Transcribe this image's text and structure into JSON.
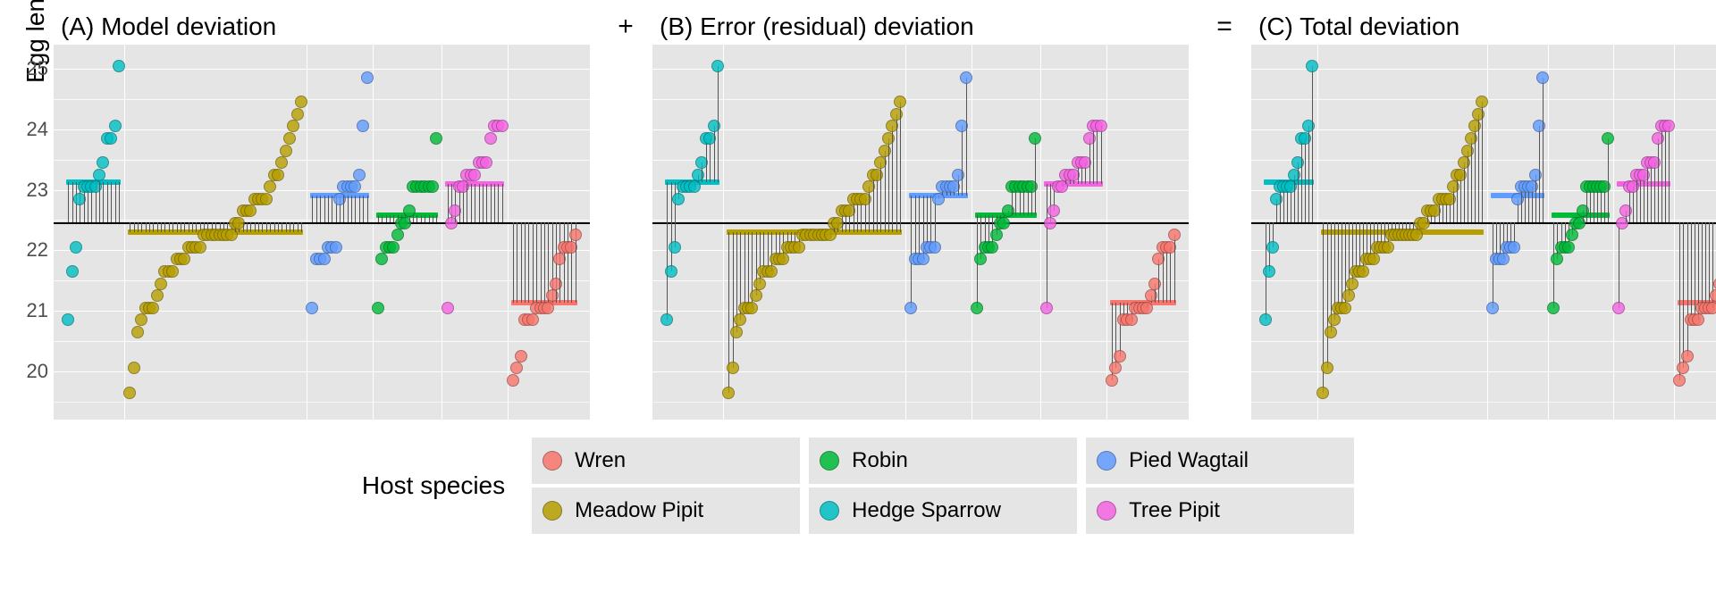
{
  "chart_data": {
    "type": "scatter",
    "ylabel": "Egg length",
    "xlabel_title": "Host species",
    "ylim": [
      19.2,
      25.4
    ],
    "yticks_major": [
      20,
      21,
      22,
      23,
      24,
      25
    ],
    "grand_mean": 22.46,
    "panels": [
      {
        "key": "A",
        "title": "(A) Model deviation",
        "after": "+",
        "stems_from": "baseline_to_mean"
      },
      {
        "key": "B",
        "title": "(B) Error (residual) deviation",
        "after": "=",
        "stems_from": "mean_to_point"
      },
      {
        "key": "C",
        "title": "(C) Total deviation",
        "after": "",
        "stems_from": "baseline_to_point"
      }
    ],
    "species_order": [
      "Hedge Sparrow",
      "Meadow Pipit",
      "Pied Wagtail",
      "Robin",
      "Tree Pipit",
      "Wren"
    ],
    "colors": {
      "Wren": "#f8766d",
      "Meadow Pipit": "#b79f00",
      "Robin": "#00ba38",
      "Hedge Sparrow": "#00bfc4",
      "Pied Wagtail": "#619cff",
      "Tree Pipit": "#f564e3"
    },
    "group_means": {
      "Hedge Sparrow": 23.12,
      "Meadow Pipit": 22.3,
      "Pied Wagtail": 22.9,
      "Robin": 22.58,
      "Tree Pipit": 23.09,
      "Wren": 21.13
    },
    "series": {
      "Hedge Sparrow": [
        20.85,
        21.65,
        22.05,
        22.85,
        23.05,
        23.05,
        23.05,
        23.05,
        23.25,
        23.45,
        23.85,
        23.85,
        24.05,
        25.05
      ],
      "Meadow Pipit": [
        19.65,
        20.05,
        20.65,
        20.85,
        21.05,
        21.05,
        21.05,
        21.25,
        21.45,
        21.65,
        21.65,
        21.65,
        21.85,
        21.85,
        21.85,
        22.05,
        22.05,
        22.05,
        22.05,
        22.25,
        22.25,
        22.25,
        22.25,
        22.25,
        22.25,
        22.25,
        22.25,
        22.45,
        22.45,
        22.65,
        22.65,
        22.65,
        22.85,
        22.85,
        22.85,
        22.85,
        23.05,
        23.25,
        23.25,
        23.45,
        23.65,
        23.85,
        24.05,
        24.25,
        24.45
      ],
      "Pied Wagtail": [
        21.05,
        21.85,
        21.85,
        21.85,
        22.05,
        22.05,
        22.05,
        22.85,
        23.05,
        23.05,
        23.05,
        23.05,
        23.25,
        24.05,
        24.85
      ],
      "Robin": [
        21.05,
        21.85,
        22.05,
        22.05,
        22.05,
        22.25,
        22.45,
        22.45,
        22.65,
        23.05,
        23.05,
        23.05,
        23.05,
        23.05,
        23.85,
        23.05
      ],
      "Tree Pipit": [
        21.05,
        22.45,
        22.65,
        23.05,
        23.05,
        23.25,
        23.25,
        23.25,
        23.45,
        23.45,
        23.45,
        23.85,
        24.05,
        24.05,
        24.05
      ],
      "Wren": [
        19.85,
        20.05,
        20.25,
        20.85,
        20.85,
        20.85,
        21.05,
        21.05,
        21.05,
        21.05,
        21.25,
        21.45,
        21.85,
        22.05,
        22.05,
        22.05,
        22.25
      ]
    },
    "legend_order": [
      "Wren",
      "Robin",
      "Pied Wagtail",
      "Meadow Pipit",
      "Hedge Sparrow",
      "Tree Pipit"
    ]
  }
}
